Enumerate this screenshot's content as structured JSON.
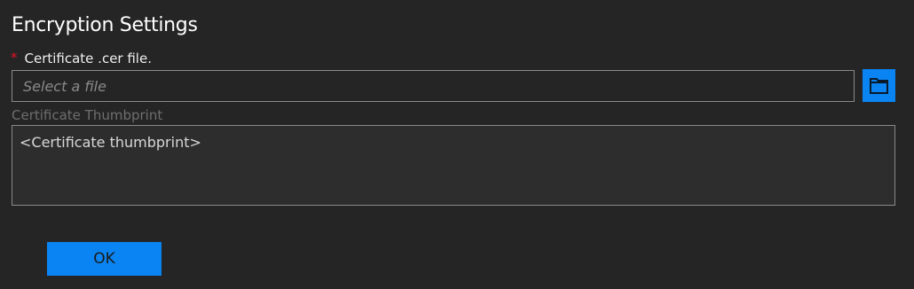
{
  "dialog": {
    "title": "Encryption Settings"
  },
  "certificate_file": {
    "required_marker": "*",
    "label": "Certificate .cer file.",
    "value": "",
    "placeholder": "Select a file",
    "browse_icon": "folder-icon"
  },
  "thumbprint": {
    "label": "Certificate Thumbprint",
    "value": "<Certificate thumbprint>"
  },
  "actions": {
    "ok_label": "OK"
  },
  "colors": {
    "background": "#252526",
    "accent": "#0a84f2",
    "required": "#e81123",
    "border": "#8a8a8a",
    "muted_label": "#6e6e6e"
  }
}
